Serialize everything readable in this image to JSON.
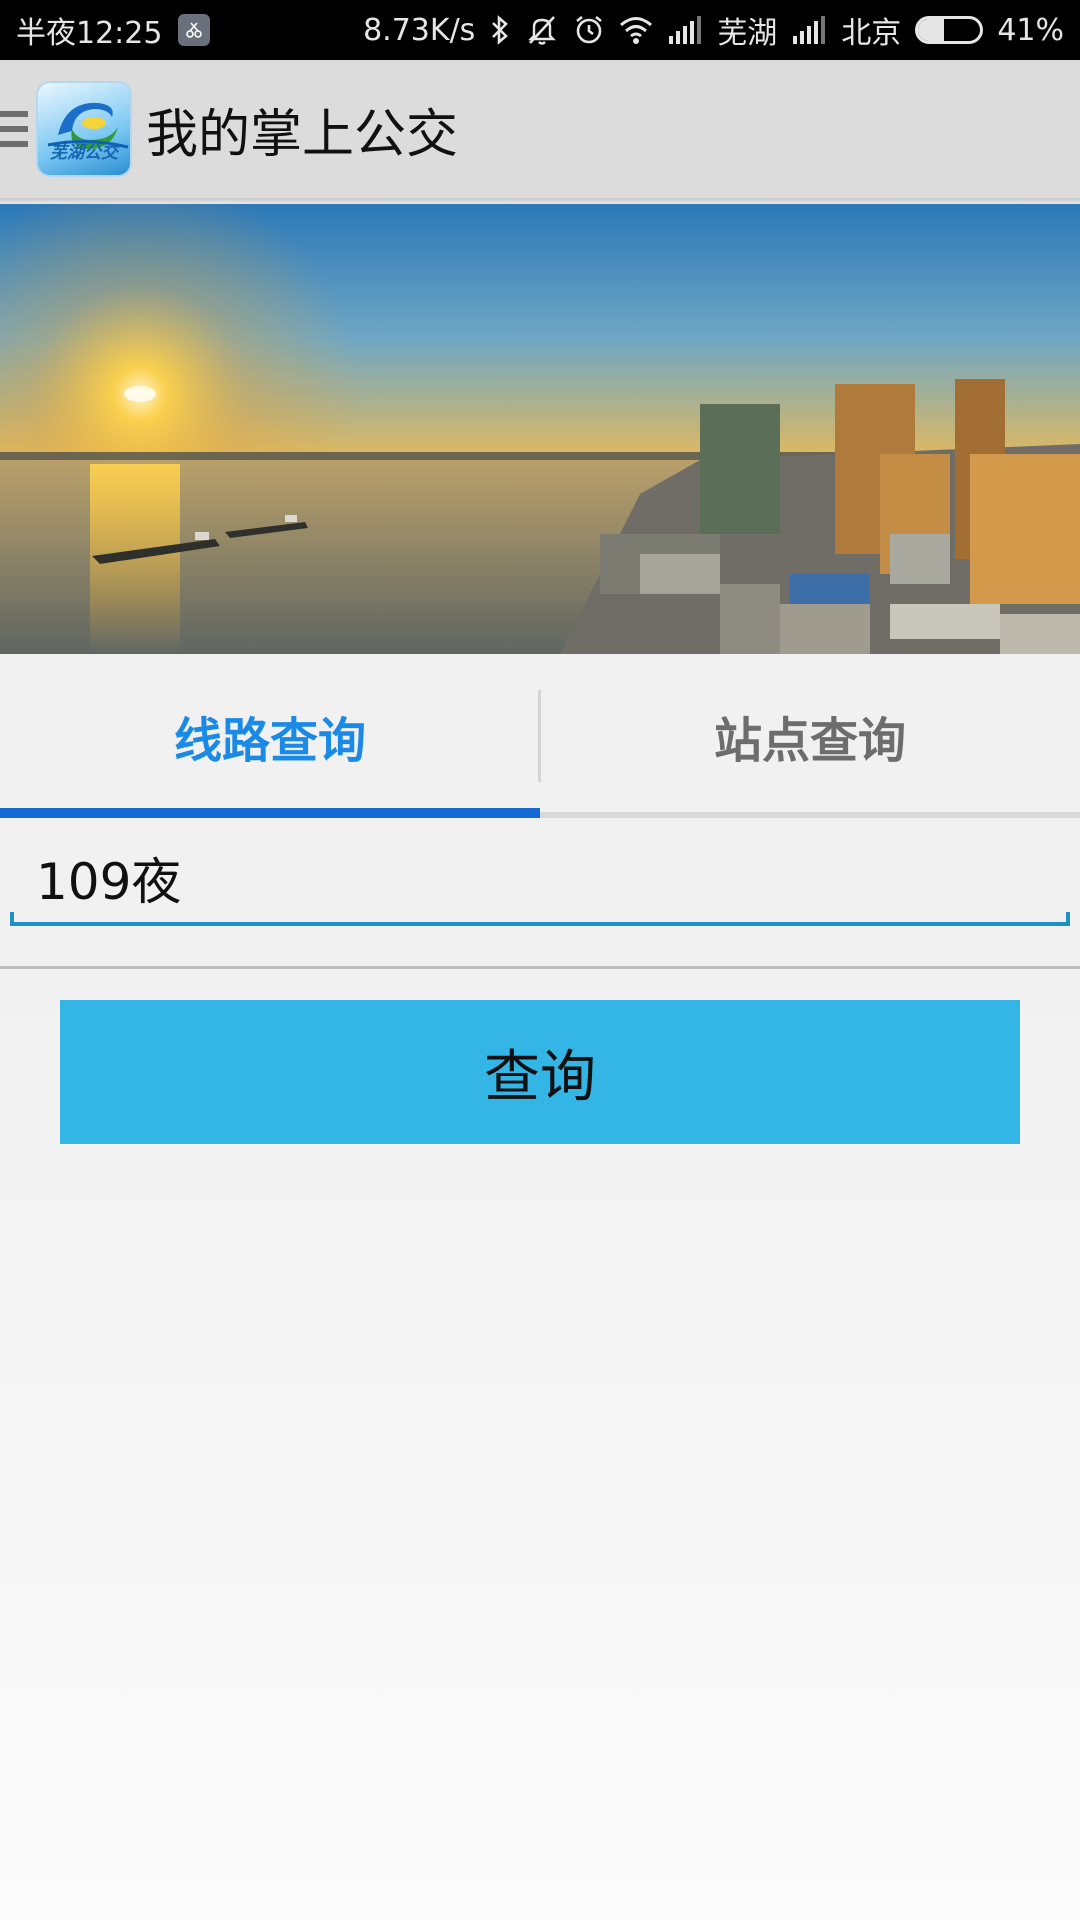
{
  "status_bar": {
    "time": "半夜12:25",
    "net_speed": "8.73K/s",
    "carrier_1": "芜湖",
    "carrier_2": "北京",
    "battery_percent": "41%",
    "battery_level": 0.41,
    "icons": [
      "screenshot-app-icon",
      "bluetooth-icon",
      "mute-vibrate-icon",
      "alarm-icon",
      "wifi-icon",
      "signal-icon",
      "signal-icon",
      "battery-icon"
    ]
  },
  "app_bar": {
    "title": "我的掌上公交",
    "logo_text": "芜湖公交",
    "icons": [
      "menu-icon",
      "app-logo"
    ]
  },
  "tabs": [
    {
      "label": "线路查询",
      "active": true
    },
    {
      "label": "站点查询",
      "active": false
    }
  ],
  "route_input": {
    "value": "109夜"
  },
  "query_button": {
    "label": "查询"
  },
  "colors": {
    "active_tab": "#1a8ae6",
    "active_underline": "#1469d4",
    "button": "#33b5e5",
    "app_bar": "#dcdcdc",
    "input_line": "#1d8fc9"
  }
}
